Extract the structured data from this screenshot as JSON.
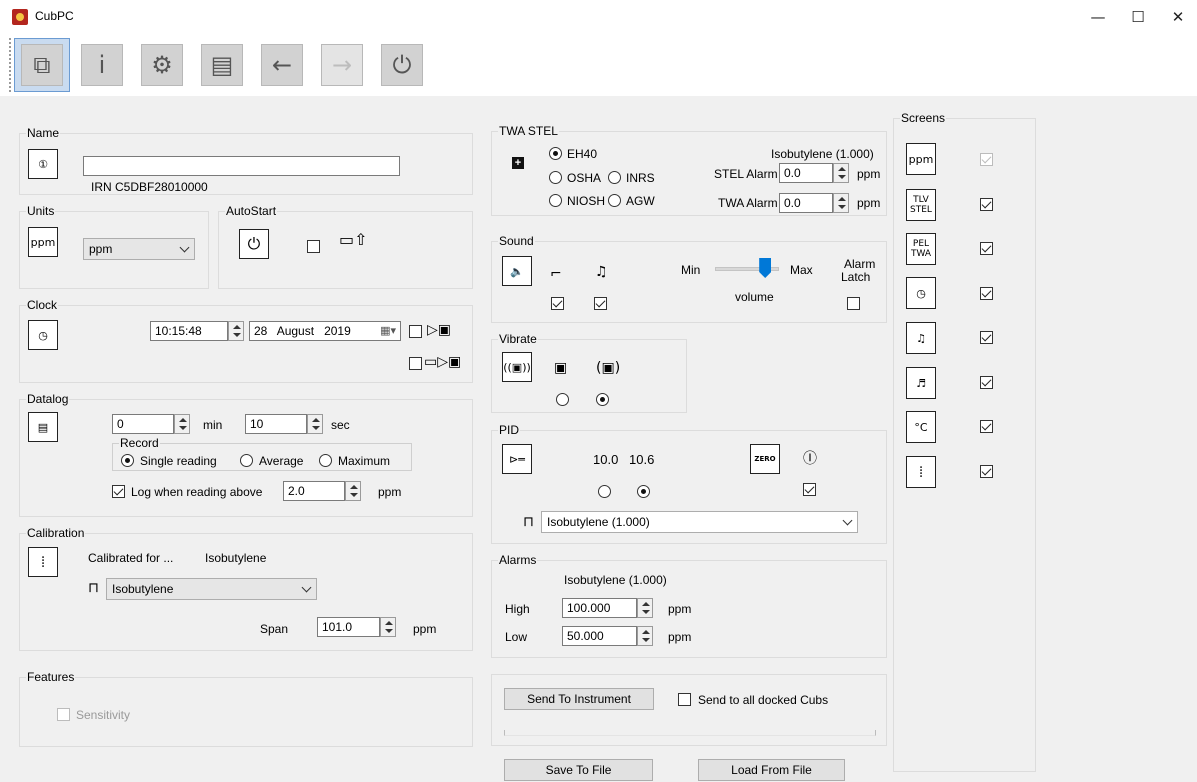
{
  "window": {
    "title": "CubPC",
    "minimize": "—",
    "maximize": "☐",
    "close": "✕"
  },
  "name": {
    "label": "Name",
    "value": "",
    "serial": "IRN C5DBF28010000"
  },
  "units": {
    "label": "Units",
    "icon_text": "ppm",
    "selected": "ppm"
  },
  "autostart": {
    "label": "AutoStart",
    "checked": false
  },
  "clock": {
    "label": "Clock",
    "time": "10:15:48",
    "date_day": "28",
    "date_month": "August",
    "date_year": "2019"
  },
  "datalog": {
    "label": "Datalog",
    "interval_min": "0",
    "min_unit": "min",
    "interval_sec": "10",
    "sec_unit": "sec",
    "record_label": "Record",
    "record_options": [
      "Single reading",
      "Average",
      "Maximum"
    ],
    "record_selected": "Single reading",
    "log_above_label": "Log when reading above",
    "log_above_checked": true,
    "log_above_value": "2.0",
    "log_above_unit": "ppm"
  },
  "calibration": {
    "label": "Calibration",
    "calibrated_for_label": "Calibrated for ...",
    "calibrated_for_value": "Isobutylene",
    "gas_selected": "Isobutylene",
    "span_label": "Span",
    "span_value": "101.0",
    "span_unit": "ppm"
  },
  "features": {
    "label": "Features",
    "sensitivity_label": "Sensitivity",
    "sensitivity_checked": false
  },
  "twa_stel": {
    "label": "TWA STEL",
    "gas": "Isobutylene (1.000)",
    "options": [
      "EH40",
      "OSHA",
      "INRS",
      "NIOSH",
      "AGW"
    ],
    "selected": "EH40",
    "stel_alarm_label": "STEL Alarm",
    "stel_alarm_value": "0.0",
    "twa_alarm_label": "TWA Alarm",
    "twa_alarm_value": "0.0",
    "unit": "ppm"
  },
  "sound": {
    "label": "Sound",
    "min_label": "Min",
    "max_label": "Max",
    "volume_label": "volume",
    "volume_level": 0.85,
    "alarm_latch_label_1": "Alarm",
    "alarm_latch_label_2": "Latch",
    "switch_checked": true,
    "bell_checked": true,
    "latch_checked": false
  },
  "vibrate": {
    "label": "Vibrate",
    "selected_index": 1
  },
  "pid": {
    "label": "PID",
    "lamp_options": [
      "10.0",
      "10.6"
    ],
    "lamp_selected": "10.6",
    "zero_label": "ZERO",
    "zero_checked": true,
    "gas_selected": "Isobutylene (1.000)"
  },
  "alarms": {
    "label": "Alarms",
    "gas": "Isobutylene (1.000)",
    "high_label": "High",
    "high_value": "100.000",
    "low_label": "Low",
    "low_value": "50.000",
    "unit": "ppm"
  },
  "send": {
    "send_button": "Send To Instrument",
    "send_all_label": "Send to all docked Cubs",
    "send_all_checked": false
  },
  "file": {
    "save_button": "Save To File",
    "load_button": "Load From File"
  },
  "screens": {
    "label": "Screens",
    "items": [
      {
        "icon_text": "ppm",
        "checked": true,
        "disabled": true
      },
      {
        "icon_text": "TLV STEL",
        "checked": true,
        "disabled": false
      },
      {
        "icon_text": "PEL TWA",
        "checked": true,
        "disabled": false
      },
      {
        "icon_text": "clock",
        "checked": true,
        "disabled": false
      },
      {
        "icon_text": "bell",
        "checked": true,
        "disabled": false
      },
      {
        "icon_text": "bell-alarm",
        "checked": true,
        "disabled": false
      },
      {
        "icon_text": "°C",
        "checked": true,
        "disabled": false
      },
      {
        "icon_text": "battery",
        "checked": true,
        "disabled": false
      }
    ]
  }
}
